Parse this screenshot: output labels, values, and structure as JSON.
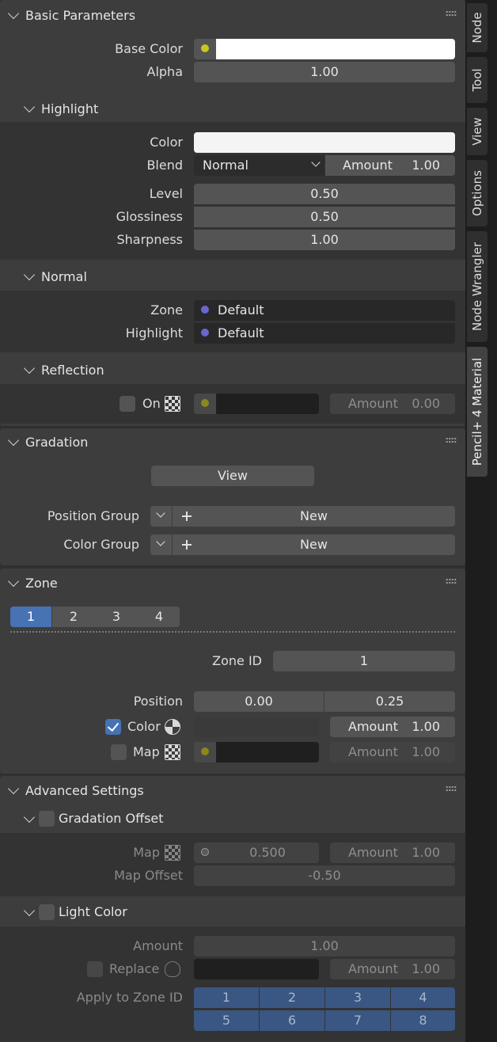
{
  "colors": {
    "yellow_dot": "#c9c61f",
    "blue_dot": "#6a66cf",
    "accent": "#4772b3",
    "olive_dot": "#8a8620"
  },
  "basic": {
    "title": "Basic Parameters",
    "base_color_label": "Base Color",
    "alpha_label": "Alpha",
    "alpha_value": "1.00"
  },
  "highlight": {
    "title": "Highlight",
    "color_label": "Color",
    "blend_label": "Blend",
    "blend_value": "Normal",
    "amount_label": "Amount",
    "amount_value": "1.00",
    "level_label": "Level",
    "level_value": "0.50",
    "gloss_label": "Glossiness",
    "gloss_value": "0.50",
    "sharp_label": "Sharpness",
    "sharp_value": "1.00"
  },
  "normal": {
    "title": "Normal",
    "zone_label": "Zone",
    "zone_value": "Default",
    "highlight_label": "Highlight",
    "highlight_value": "Default"
  },
  "reflection": {
    "title": "Reflection",
    "on_label": "On",
    "amount_label": "Amount",
    "amount_value": "0.00"
  },
  "gradation": {
    "title": "Gradation",
    "view_label": "View",
    "position_group_label": "Position Group",
    "color_group_label": "Color Group",
    "new_label": "New"
  },
  "zone": {
    "title": "Zone",
    "tabs": [
      "1",
      "2",
      "3",
      "4"
    ],
    "zone_id_label": "Zone ID",
    "zone_id_value": "1",
    "position_label": "Position",
    "position_a": "0.00",
    "position_b": "0.25",
    "color_label": "Color",
    "amount_label": "Amount",
    "color_amount": "1.00",
    "map_label": "Map",
    "map_amount": "1.00"
  },
  "advanced": {
    "title": "Advanced Settings",
    "grad_offset_title": "Gradation Offset",
    "map_label": "Map",
    "map_value": "0.500",
    "amount_label": "Amount",
    "map_amount": "1.00",
    "map_offset_label": "Map Offset",
    "map_offset_value": "-0.50",
    "light_color_title": "Light Color",
    "lc_amount_label": "Amount",
    "lc_amount_value": "1.00",
    "replace_label": "Replace",
    "replace_amount": "1.00",
    "apply_label": "Apply to Zone ID",
    "apply_ids": [
      "1",
      "2",
      "3",
      "4",
      "5",
      "6",
      "7",
      "8"
    ]
  },
  "sidebar_tabs": [
    "Node",
    "Tool",
    "View",
    "Options",
    "Node Wrangler",
    "Pencil+ 4 Material"
  ]
}
